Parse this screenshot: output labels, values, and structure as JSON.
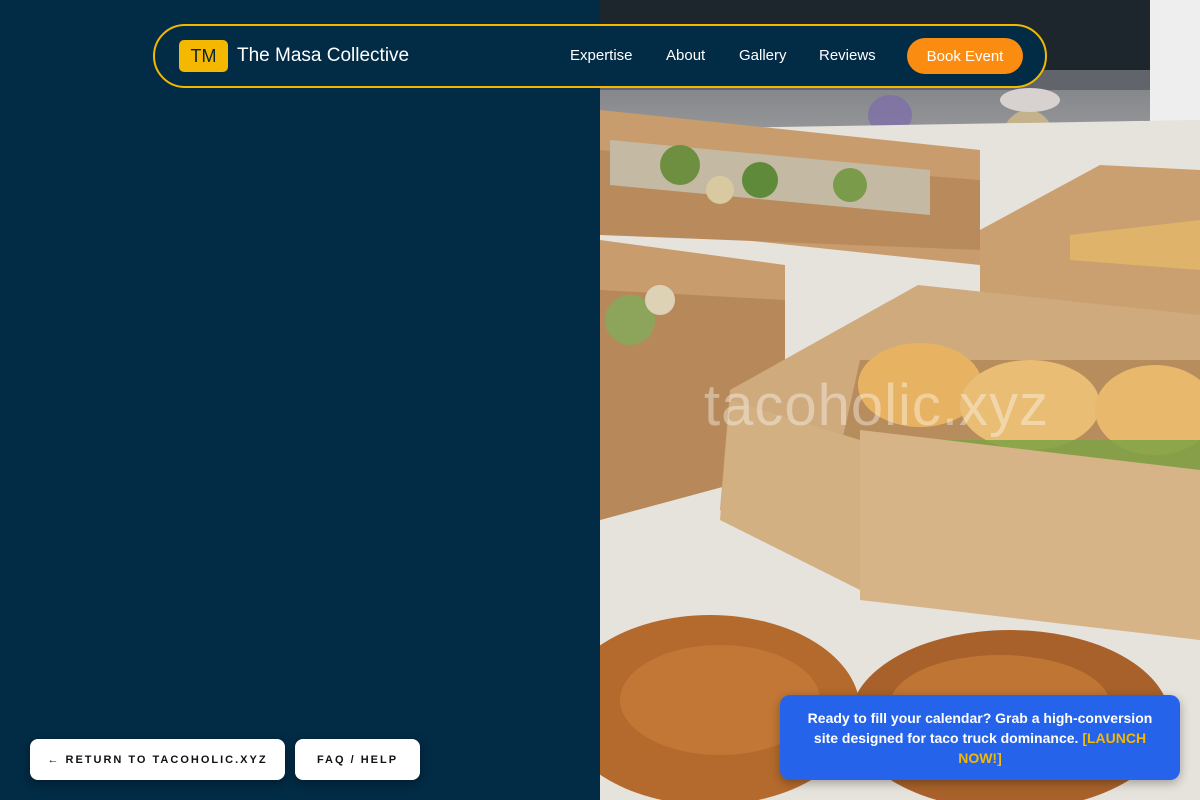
{
  "brand": {
    "badge": "TM",
    "name": "The Masa Collective"
  },
  "nav": {
    "links": [
      "Expertise",
      "About",
      "Gallery",
      "Reviews"
    ],
    "cta": "Book Event"
  },
  "hero": {
    "watermark": "tacoholic.xyz",
    "photo_subject": "catering-boxes-photo"
  },
  "footer_buttons": {
    "return": "← RETURN TO TACOHOLIC.XYZ",
    "faq": "FAQ / HELP"
  },
  "promo": {
    "text": "Ready to fill your calendar? Grab a high-conversion site designed for taco truck dominance.",
    "cta": "[LAUNCH NOW!]"
  },
  "colors": {
    "navy": "#022b45",
    "accent_yellow": "#f5b800",
    "accent_orange": "#fb8c12",
    "promo_blue": "#2563eb"
  }
}
